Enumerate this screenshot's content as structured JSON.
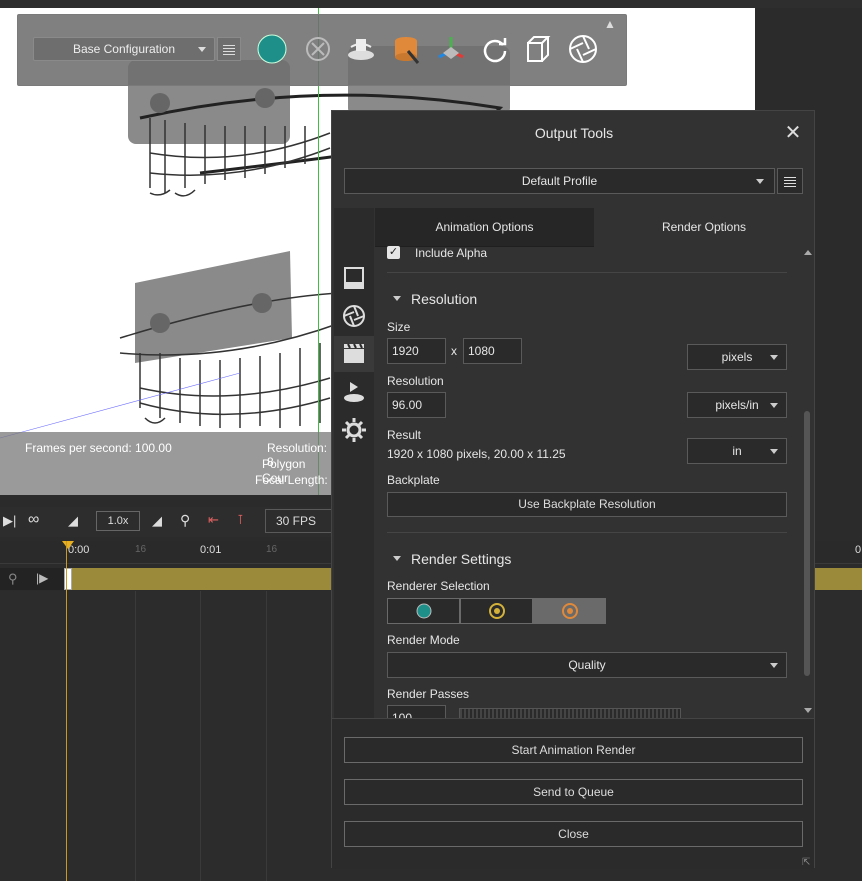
{
  "toolbar": {
    "config_label": "Base Configuration",
    "icons": [
      "teal-circle-icon",
      "scene-icon",
      "turntable-icon",
      "database-icon",
      "axis-icon",
      "refresh-icon",
      "export-cube-icon",
      "aperture-icon"
    ]
  },
  "overlay": {
    "fps": "Frames per second: 100.00",
    "resolution": "Resolution: 8",
    "polygon": "Polygon Cour",
    "focal": "Focal Length:"
  },
  "timeline": {
    "speed": "1.0x",
    "fps_select": "30 FPS",
    "ruler": {
      "t0": "0:00",
      "t1": "16",
      "t2": "0:01",
      "t3": "16",
      "t_right": "0"
    }
  },
  "panel": {
    "title": "Output Tools",
    "profile": "Default Profile",
    "tabs": {
      "animation": "Animation Options",
      "render": "Render Options"
    },
    "include_alpha": "Include Alpha",
    "resolution_section": "Resolution",
    "size_label": "Size",
    "width": "1920",
    "x_sep": "x",
    "height": "1080",
    "size_unit": "pixels",
    "resolution_label": "Resolution",
    "dpi": "96.00",
    "dpi_unit": "pixels/in",
    "result_label": "Result",
    "result_value": "1920 x 1080 pixels, 20.00 x 11.25",
    "result_unit": "in",
    "backplate_label": "Backplate",
    "backplate_button": "Use Backplate Resolution",
    "render_settings_section": "Render Settings",
    "renderer_selection_label": "Renderer Selection",
    "render_mode_label": "Render Mode",
    "render_mode_value": "Quality",
    "render_passes_label": "Render Passes",
    "render_passes_value": "100",
    "buttons": {
      "start": "Start Animation Render",
      "queue": "Send to Queue",
      "close": "Close"
    }
  },
  "colors": {
    "accent_teal": "#1f8f8a",
    "renderer_orange": "#e0893a",
    "renderer_gold": "#d4b23a",
    "timeline_gold": "#9b8a3a"
  }
}
